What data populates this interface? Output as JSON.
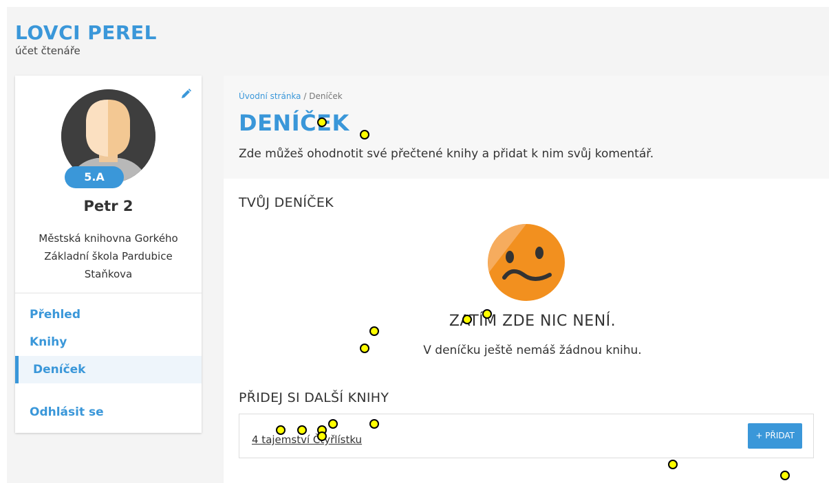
{
  "brand": {
    "title": "LOVCI PEREL",
    "subtitle": "účet čtenáře"
  },
  "sidebar": {
    "class_badge": "5.A",
    "user_name": "Petr 2",
    "library": "Městská knihovna Gorkého",
    "school_line1": "Základní škola Pardubice",
    "school_line2": "Staňkova",
    "nav": [
      {
        "label": "Přehled"
      },
      {
        "label": "Knihy"
      },
      {
        "label": "Deníček"
      },
      {
        "label": "Odhlásit se"
      }
    ],
    "active_item": "Deníček"
  },
  "main": {
    "breadcrumb": {
      "home": "Úvodní stránka",
      "separator": " / ",
      "current": "Deníček"
    },
    "title": "DENÍČEK",
    "description": "Zde můžeš ohodnotit své přečtené knihy a přidat k nim svůj komentář.",
    "diary_section_title": "TVŮJ DENÍČEK",
    "empty_title": "ZATÍM ZDE NIC NENÍ.",
    "empty_desc": "V deníčku ještě nemáš žádnou knihu.",
    "add_section_title": "PŘIDEJ SI DALŠÍ KNIHY",
    "book_title": "4 tajemství Čtyřlístku",
    "add_button_label": "PŘIDAT"
  },
  "colors": {
    "accent": "#3a97d9",
    "face": "#f2901f",
    "marker": "#ffff00"
  },
  "icons": {
    "edit": "pencil-icon",
    "add": "plus-icon",
    "empty": "sad-face-icon"
  }
}
